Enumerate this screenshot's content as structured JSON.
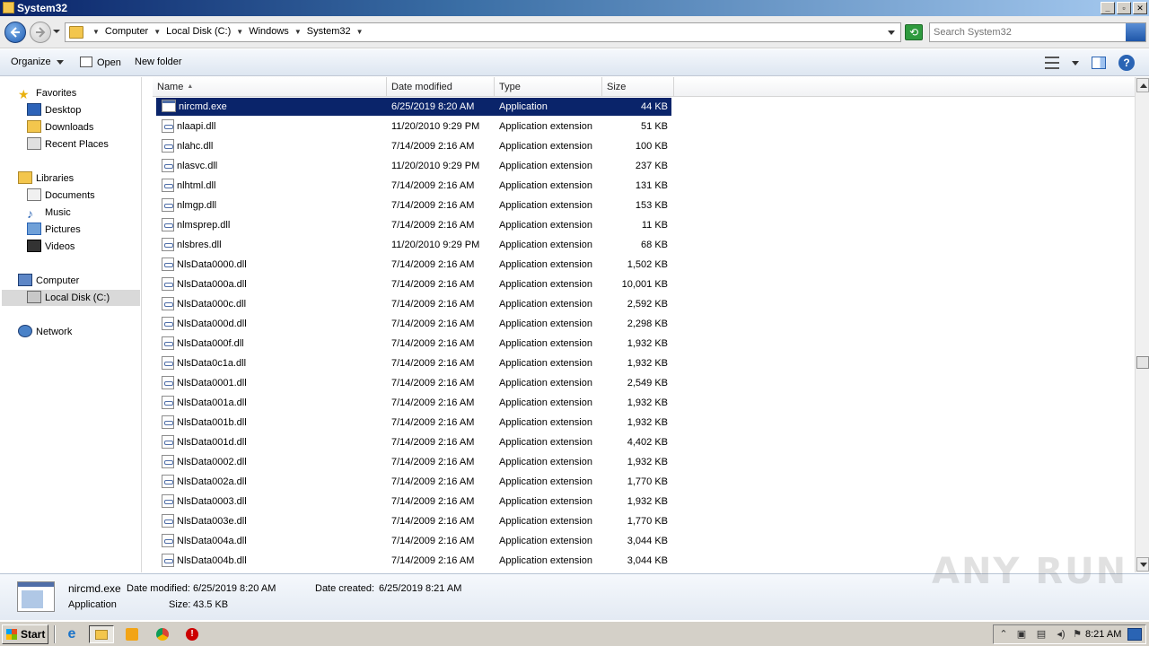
{
  "window": {
    "title": "System32"
  },
  "address": {
    "crumbs": [
      "Computer",
      "Local Disk (C:)",
      "Windows",
      "System32"
    ]
  },
  "search": {
    "placeholder": "Search System32"
  },
  "toolbar": {
    "organize": "Organize",
    "open": "Open",
    "new_folder": "New folder"
  },
  "nav": {
    "favorites": "Favorites",
    "desktop": "Desktop",
    "downloads": "Downloads",
    "recent_places": "Recent Places",
    "libraries": "Libraries",
    "documents": "Documents",
    "music": "Music",
    "pictures": "Pictures",
    "videos": "Videos",
    "computer": "Computer",
    "local_disk": "Local Disk (C:)",
    "network": "Network"
  },
  "columns": {
    "name": "Name",
    "date": "Date modified",
    "type": "Type",
    "size": "Size"
  },
  "files": [
    {
      "name": "nircmd.exe",
      "date": "6/25/2019 8:20 AM",
      "type": "Application",
      "size": "44 KB"
    },
    {
      "name": "nlaapi.dll",
      "date": "11/20/2010 9:29 PM",
      "type": "Application extension",
      "size": "51 KB"
    },
    {
      "name": "nlahc.dll",
      "date": "7/14/2009 2:16 AM",
      "type": "Application extension",
      "size": "100 KB"
    },
    {
      "name": "nlasvc.dll",
      "date": "11/20/2010 9:29 PM",
      "type": "Application extension",
      "size": "237 KB"
    },
    {
      "name": "nlhtml.dll",
      "date": "7/14/2009 2:16 AM",
      "type": "Application extension",
      "size": "131 KB"
    },
    {
      "name": "nlmgp.dll",
      "date": "7/14/2009 2:16 AM",
      "type": "Application extension",
      "size": "153 KB"
    },
    {
      "name": "nlmsprep.dll",
      "date": "7/14/2009 2:16 AM",
      "type": "Application extension",
      "size": "11 KB"
    },
    {
      "name": "nlsbres.dll",
      "date": "11/20/2010 9:29 PM",
      "type": "Application extension",
      "size": "68 KB"
    },
    {
      "name": "NlsData0000.dll",
      "date": "7/14/2009 2:16 AM",
      "type": "Application extension",
      "size": "1,502 KB"
    },
    {
      "name": "NlsData000a.dll",
      "date": "7/14/2009 2:16 AM",
      "type": "Application extension",
      "size": "10,001 KB"
    },
    {
      "name": "NlsData000c.dll",
      "date": "7/14/2009 2:16 AM",
      "type": "Application extension",
      "size": "2,592 KB"
    },
    {
      "name": "NlsData000d.dll",
      "date": "7/14/2009 2:16 AM",
      "type": "Application extension",
      "size": "2,298 KB"
    },
    {
      "name": "NlsData000f.dll",
      "date": "7/14/2009 2:16 AM",
      "type": "Application extension",
      "size": "1,932 KB"
    },
    {
      "name": "NlsData0c1a.dll",
      "date": "7/14/2009 2:16 AM",
      "type": "Application extension",
      "size": "1,932 KB"
    },
    {
      "name": "NlsData0001.dll",
      "date": "7/14/2009 2:16 AM",
      "type": "Application extension",
      "size": "2,549 KB"
    },
    {
      "name": "NlsData001a.dll",
      "date": "7/14/2009 2:16 AM",
      "type": "Application extension",
      "size": "1,932 KB"
    },
    {
      "name": "NlsData001b.dll",
      "date": "7/14/2009 2:16 AM",
      "type": "Application extension",
      "size": "1,932 KB"
    },
    {
      "name": "NlsData001d.dll",
      "date": "7/14/2009 2:16 AM",
      "type": "Application extension",
      "size": "4,402 KB"
    },
    {
      "name": "NlsData0002.dll",
      "date": "7/14/2009 2:16 AM",
      "type": "Application extension",
      "size": "1,932 KB"
    },
    {
      "name": "NlsData002a.dll",
      "date": "7/14/2009 2:16 AM",
      "type": "Application extension",
      "size": "1,770 KB"
    },
    {
      "name": "NlsData0003.dll",
      "date": "7/14/2009 2:16 AM",
      "type": "Application extension",
      "size": "1,932 KB"
    },
    {
      "name": "NlsData003e.dll",
      "date": "7/14/2009 2:16 AM",
      "type": "Application extension",
      "size": "1,770 KB"
    },
    {
      "name": "NlsData004a.dll",
      "date": "7/14/2009 2:16 AM",
      "type": "Application extension",
      "size": "3,044 KB"
    },
    {
      "name": "NlsData004b.dll",
      "date": "7/14/2009 2:16 AM",
      "type": "Application extension",
      "size": "3,044 KB"
    }
  ],
  "selected_index": 0,
  "details": {
    "name": "nircmd.exe",
    "type": "Application",
    "modified_label": "Date modified:",
    "modified": "6/25/2019 8:20 AM",
    "size_label": "Size:",
    "size": "43.5 KB",
    "created_label": "Date created:",
    "created": "6/25/2019 8:21 AM"
  },
  "watermark": "ANY RUN",
  "taskbar": {
    "start": "Start",
    "clock": "8:21 AM"
  },
  "colors": {
    "selection": "#0a246a",
    "title_start": "#0a246a",
    "title_end": "#a6caf0"
  }
}
